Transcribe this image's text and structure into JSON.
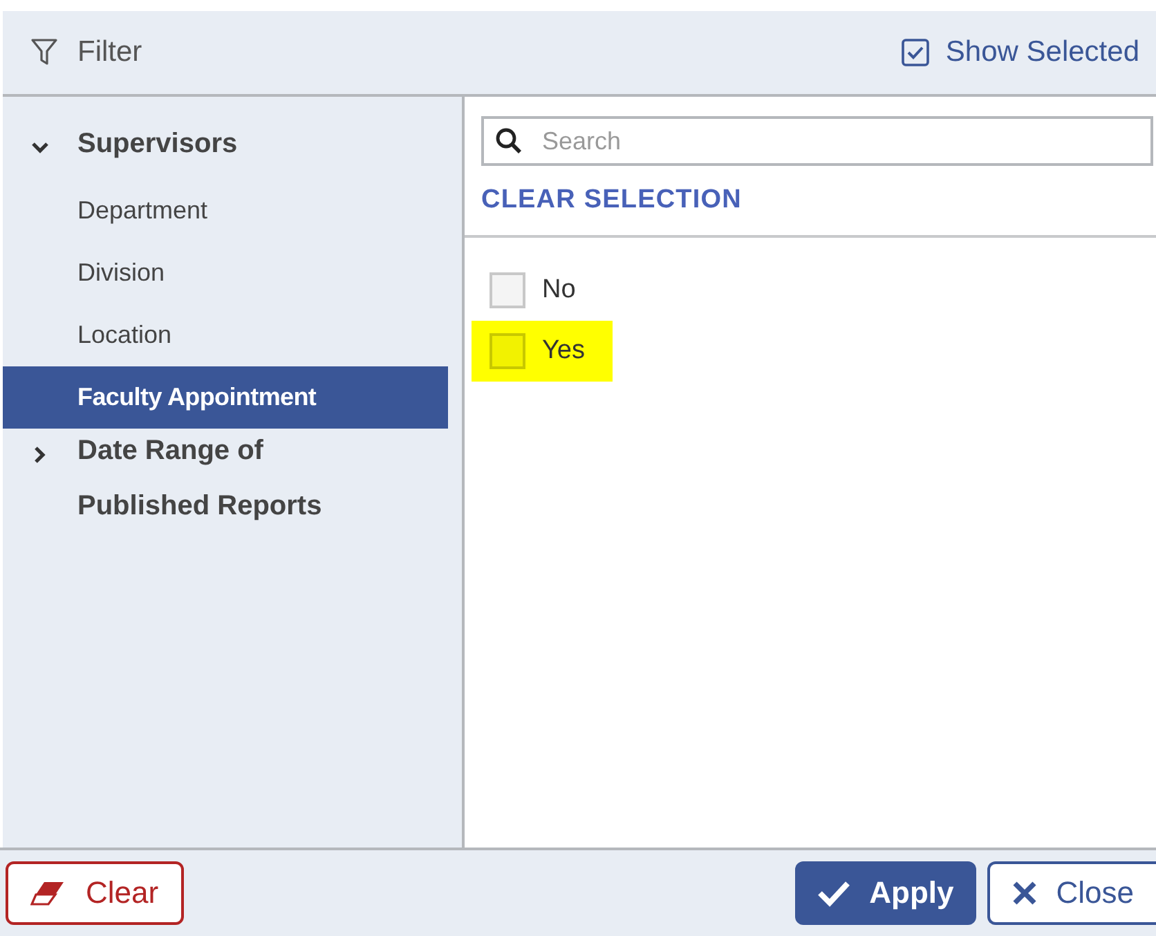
{
  "header": {
    "title": "Filter",
    "show_selected": {
      "label": "Show Selected",
      "checked": true
    }
  },
  "sidebar": {
    "groups": [
      {
        "label": "Supervisors",
        "expanded": true,
        "children": [
          {
            "label": "Department",
            "selected": false
          },
          {
            "label": "Division",
            "selected": false
          },
          {
            "label": "Location",
            "selected": false
          },
          {
            "label": "Faculty Appointment",
            "selected": true
          }
        ]
      },
      {
        "label": "Date Range of Published Reports",
        "expanded": false
      }
    ]
  },
  "search": {
    "placeholder": "Search"
  },
  "clear_selection": "CLEAR SELECTION",
  "options": [
    {
      "label": "No",
      "checked": false,
      "highlighted": false
    },
    {
      "label": "Yes",
      "checked": false,
      "highlighted": true
    }
  ],
  "footer": {
    "clear": "Clear",
    "apply": "Apply",
    "close": "Close"
  }
}
